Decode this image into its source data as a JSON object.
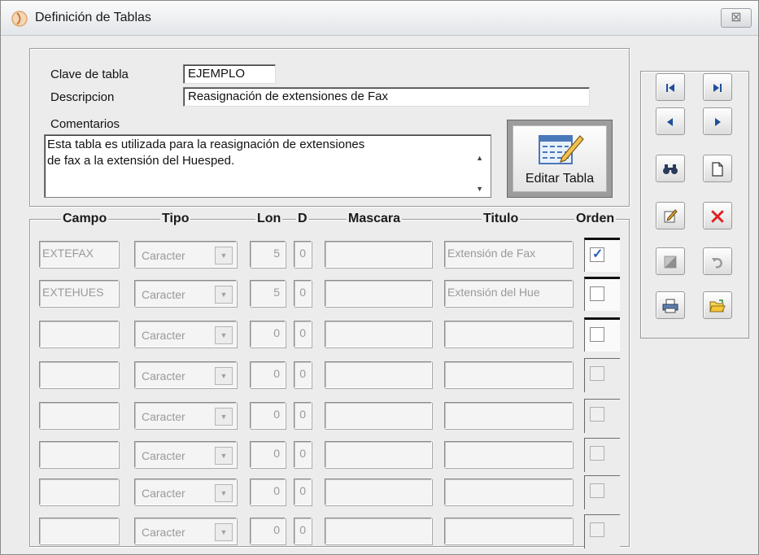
{
  "window": {
    "title": "Definición de Tablas",
    "close_glyph": "⊠"
  },
  "header": {
    "clave_label": "Clave de tabla",
    "clave_value": "EJEMPLO",
    "descripcion_label": "Descripcion",
    "descripcion_value": "Reasignación de extensiones de Fax",
    "comentarios_label": "Comentarios",
    "comentarios_line1": "Esta tabla es utilizada para la reasignación de extensiones",
    "comentarios_line2": "de fax a la extensión del Huesped.",
    "edit_button_label": "Editar Tabla"
  },
  "columns": {
    "campo": "Campo",
    "tipo": "Tipo",
    "lon": "Lon",
    "d": "D",
    "mascara": "Mascara",
    "titulo": "Titulo",
    "orden": "Orden"
  },
  "rows": [
    {
      "campo": "EXTEFAX",
      "tipo": "Caracter",
      "lon": "5",
      "d": "0",
      "mascara": "",
      "titulo": "Extensión de Fax",
      "orden": true
    },
    {
      "campo": "EXTEHUES",
      "tipo": "Caracter",
      "lon": "5",
      "d": "0",
      "mascara": "",
      "titulo": "Extensión del Hue",
      "orden": false
    },
    {
      "campo": "",
      "tipo": "Caracter",
      "lon": "0",
      "d": "0",
      "mascara": "",
      "titulo": "",
      "orden": false
    },
    {
      "campo": "",
      "tipo": "Caracter",
      "lon": "0",
      "d": "0",
      "mascara": "",
      "titulo": "",
      "orden": false
    },
    {
      "campo": "",
      "tipo": "Caracter",
      "lon": "0",
      "d": "0",
      "mascara": "",
      "titulo": "",
      "orden": false
    },
    {
      "campo": "",
      "tipo": "Caracter",
      "lon": "0",
      "d": "0",
      "mascara": "",
      "titulo": "",
      "orden": false
    },
    {
      "campo": "",
      "tipo": "Caracter",
      "lon": "0",
      "d": "0",
      "mascara": "",
      "titulo": "",
      "orden": false
    },
    {
      "campo": "",
      "tipo": "Caracter",
      "lon": "0",
      "d": "0",
      "mascara": "",
      "titulo": "",
      "orden": false
    }
  ],
  "toolbar": {
    "first": "first-record-icon",
    "last": "last-record-icon",
    "prev": "previous-record-icon",
    "next": "next-record-icon",
    "find": "binoculars-icon",
    "new": "new-document-icon",
    "edit": "pencil-icon",
    "delete": "delete-x-icon",
    "save": "save-icon",
    "undo": "undo-icon",
    "print": "printer-icon",
    "open": "folder-open-icon"
  },
  "colors": {
    "delete_red": "#e02020",
    "nav_blue": "#1f4f9a",
    "check_blue": "#2e5fb0"
  }
}
